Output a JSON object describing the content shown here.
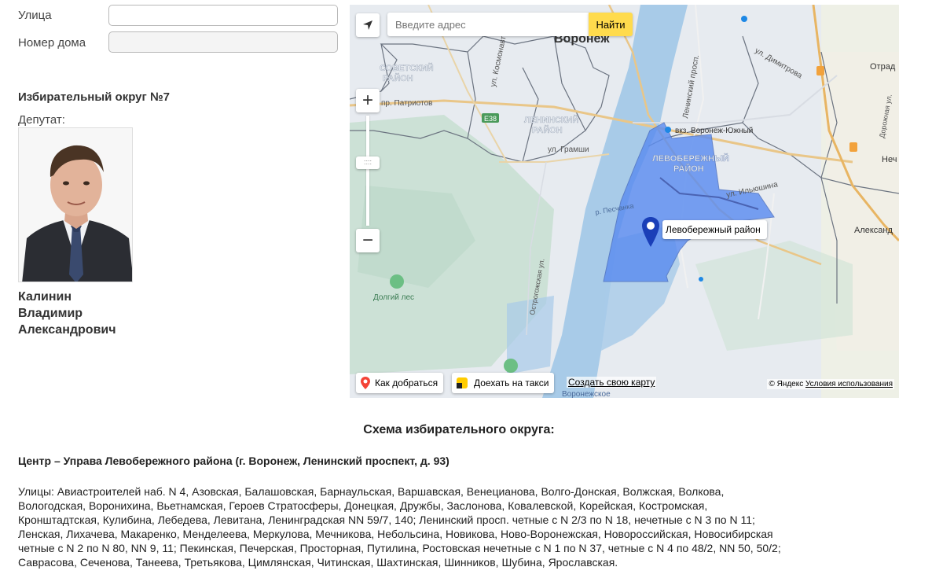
{
  "form": {
    "street_label": "Улица",
    "street_value": "",
    "house_label": "Номер дома",
    "house_value": ""
  },
  "district": {
    "title": "Избирательный округ №7",
    "deputy_label": "Депутат:",
    "deputy_name_line1": "Калинин",
    "deputy_name_line2": "Владимир",
    "deputy_name_line3": "Александрович"
  },
  "map": {
    "search_placeholder": "Введите адрес",
    "search_button": "Найти",
    "zoom_in": "+",
    "zoom_out": "−",
    "zoom_handle": "::::",
    "balloon_label": "Левобережный район",
    "route_button": "Как добраться",
    "taxi_button": "Доехать на такси",
    "create_map_link": "Создать свою карту",
    "copyright": "© Яндекс",
    "terms_link": "Условия использования",
    "labels": {
      "city": "Воронеж",
      "sovetsky": "СОВЕТСКИЙ",
      "rayon": "РАЙОН",
      "leninsky": "ЛЕНИНСКИЙ",
      "levoberezhny": "ЛЕВОБЕРЕЖНЫЙ",
      "patriotov": "пр. Патриотов",
      "kosmonavtov": "ул. Космонавтов",
      "gramshi": "ул. Грамши",
      "leninsky_prosp": "Ленинский просп.",
      "dimitrova": "ул. Димитрова",
      "ilyushina": "ул. Ильюшина",
      "station": "вкз. Воронеж-Южный",
      "pechanka": "р. Песчанка",
      "ostrogozhskaya": "Острогожская ул.",
      "dolgy_les": "Долгий лес",
      "voronezhskoe": "Воронежское",
      "otrad": "Отрад",
      "nech": "Неч",
      "aleksand": "Александ",
      "dorozhnaya": "Дорожная ул.",
      "e38": "Е38"
    },
    "colors": {
      "water": "#a8cbe8",
      "land": "#e9edf1",
      "green": "#c3dfcb",
      "district_fill": "#5c8ef0",
      "accent": "#ffdb4d"
    }
  },
  "scheme": {
    "title": "Схема избирательного округа:",
    "center": "Центр – Управа Левобережного района (г. Воронеж, Ленинский проспект, д. 93)",
    "streets_line1": "Улицы: Авиастроителей наб. N 4, Азовская, Балашовская, Барнаульская, Варшавская, Венецианова, Волго-Донская, Волжская, Волкова,",
    "streets_line2": "Вологодская, Воронихина, Вьетнамская, Героев Стратосферы, Донецкая, Дружбы, Заслонова, Ковалевской, Корейская, Костромская,",
    "streets_line3": "Кронштадтская, Кулибина, Лебедева, Левитана, Ленинградская NN 59/7, 140; Ленинский просп. четные с N 2/3 по N 18, нечетные с N 3 по N 11;",
    "streets_line4": "Ленская, Лихачева, Макаренко, Менделеева, Меркулова, Мечникова, Небольсина, Новикова, Ново-Воронежская, Новороссийская, Новосибирская",
    "streets_line5": "четные с N 2 по N 80, NN 9, 11; Пекинская, Печерская, Просторная, Путилина, Ростовская нечетные с N 1 по N 37, четные с N 4 по 48/2, NN 50, 50/2;",
    "streets_line6": "Саврасова, Сеченова, Танеева, Третьякова, Цимлянская, Читинская, Шахтинская, Шинников, Шубина, Ярославская."
  }
}
